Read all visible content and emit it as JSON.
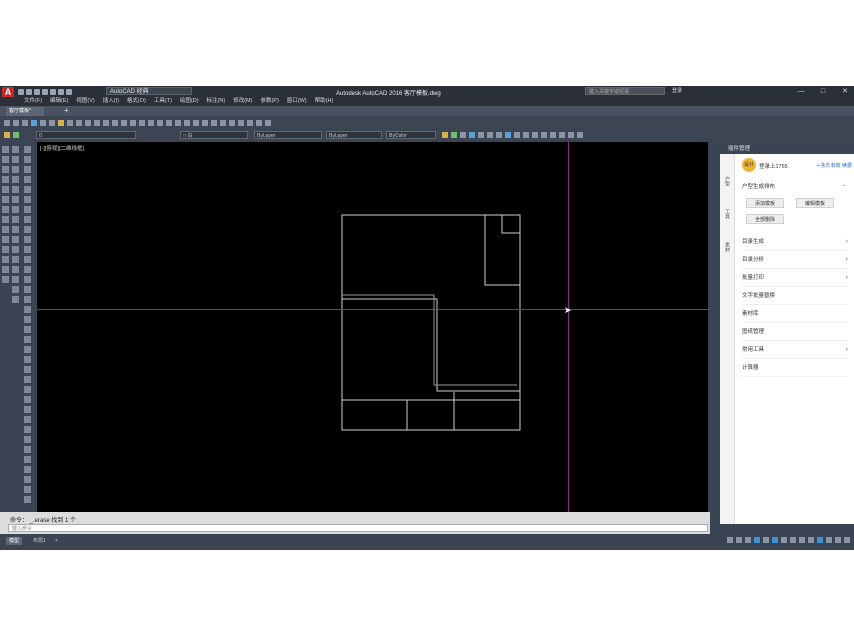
{
  "app": {
    "title": "Autodesk AutoCAD 2016    客厅模板.dwg",
    "workspace": "AutoCAD 经典",
    "search_placeholder": "键入关键字或短语",
    "signin_label": "登录",
    "window_controls": [
      "—",
      "□",
      "✕"
    ]
  },
  "menu": [
    "文件(F)",
    "编辑(E)",
    "视图(V)",
    "插入(I)",
    "格式(O)",
    "工具(T)",
    "绘图(D)",
    "标注(N)",
    "修改(M)",
    "参数(P)",
    "窗口(W)",
    "帮助(H)"
  ],
  "document_tab": {
    "label": "客厅模板*",
    "add": "+"
  },
  "properties_toolbar": {
    "layer": "0",
    "color": "□ 白",
    "linetype": "ByLayer",
    "lineweight": "ByLayer",
    "plotstyle": "ByColor"
  },
  "viewport_label": "[-][俯视][二维线框]",
  "command": {
    "history": "命令： _.erase 找到 1 个",
    "prompt": "键入命令"
  },
  "layout_tabs": [
    "模型",
    "布局1",
    "+"
  ],
  "panel": {
    "title": "插件管理",
    "side_tabs": [
      "户型",
      "工具",
      "素材"
    ],
    "user": {
      "avatar": "设计",
      "name": "登录上1765",
      "renew": "＋永久有效 续费"
    },
    "section_title": "户型生成排布",
    "buttons": [
      "添加模板",
      "编辑模板",
      "全部删除"
    ],
    "items": [
      {
        "label": "目录生成",
        "chevron": "›"
      },
      {
        "label": "目录分析",
        "chevron": "›"
      },
      {
        "label": "批量打印",
        "chevron": "›"
      },
      {
        "label": "文字批量替换",
        "chevron": ""
      },
      {
        "label": "素材库",
        "chevron": ""
      },
      {
        "label": "图纸管理",
        "chevron": ""
      },
      {
        "label": "常用工具",
        "chevron": "›"
      },
      {
        "label": "计算器",
        "chevron": ""
      }
    ]
  }
}
